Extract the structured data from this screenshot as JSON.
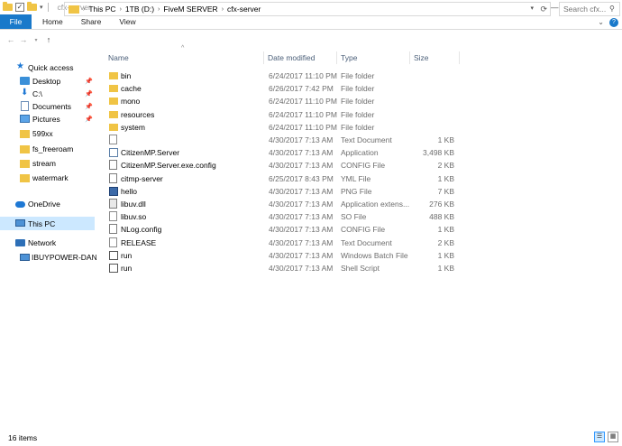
{
  "window": {
    "title": "cfx-server",
    "buttons": {
      "minimize": "—",
      "maximize": "❐",
      "close": "✕"
    }
  },
  "ribbon": {
    "tabs": [
      "File",
      "Home",
      "Share",
      "View"
    ],
    "expand": "⌄"
  },
  "address": {
    "crumbs": [
      "This PC",
      "1TB (D:)",
      "FiveM SERVER",
      "cfx-server"
    ],
    "search_placeholder": "Search cfx..."
  },
  "sidebar": {
    "items": [
      {
        "label": "Quick access",
        "icon": "star-icon",
        "pinned": false
      },
      {
        "label": "Desktop",
        "icon": "desktop-icon",
        "pinned": true
      },
      {
        "label": "C:\\",
        "icon": "download-icon",
        "pinned": true
      },
      {
        "label": "Documents",
        "icon": "document-icon",
        "pinned": true
      },
      {
        "label": "Pictures",
        "icon": "pictures-icon",
        "pinned": true
      },
      {
        "label": "599xx",
        "icon": "folder-icon",
        "pinned": false
      },
      {
        "label": "fs_freeroam",
        "icon": "folder-icon",
        "pinned": false
      },
      {
        "label": "stream",
        "icon": "folder-icon",
        "pinned": false
      },
      {
        "label": "watermark",
        "icon": "folder-icon",
        "pinned": false
      },
      {
        "label": "OneDrive",
        "icon": "cloud-icon",
        "pinned": false
      },
      {
        "label": "This PC",
        "icon": "computer-icon",
        "pinned": false,
        "selected": true
      },
      {
        "label": "Network",
        "icon": "network-icon",
        "pinned": false
      },
      {
        "label": "IBUYPOWER-DANIE",
        "icon": "computer-icon",
        "pinned": false
      }
    ]
  },
  "columns": {
    "name": "Name",
    "date": "Date modified",
    "type": "Type",
    "size": "Size"
  },
  "files": [
    {
      "name": "bin",
      "date": "6/24/2017 11:10 PM",
      "type": "File folder",
      "size": "",
      "icon": "folder-icon"
    },
    {
      "name": "cache",
      "date": "6/26/2017 7:42 PM",
      "type": "File folder",
      "size": "",
      "icon": "folder-icon"
    },
    {
      "name": "mono",
      "date": "6/24/2017 11:10 PM",
      "type": "File folder",
      "size": "",
      "icon": "folder-icon"
    },
    {
      "name": "resources",
      "date": "6/24/2017 11:10 PM",
      "type": "File folder",
      "size": "",
      "icon": "folder-icon"
    },
    {
      "name": "system",
      "date": "6/24/2017 11:10 PM",
      "type": "File folder",
      "size": "",
      "icon": "folder-icon"
    },
    {
      "name": "",
      "date": "4/30/2017 7:13 AM",
      "type": "Text Document",
      "size": "1 KB",
      "icon": "text-file-icon"
    },
    {
      "name": "CitizenMP.Server",
      "date": "4/30/2017 7:13 AM",
      "type": "Application",
      "size": "3,498 KB",
      "icon": "application-icon"
    },
    {
      "name": "CitizenMP.Server.exe.config",
      "date": "4/30/2017 7:13 AM",
      "type": "CONFIG File",
      "size": "2 KB",
      "icon": "config-file-icon"
    },
    {
      "name": "citmp-server",
      "date": "6/25/2017 8:43 PM",
      "type": "YML File",
      "size": "1 KB",
      "icon": "yml-file-icon"
    },
    {
      "name": "hello",
      "date": "4/30/2017 7:13 AM",
      "type": "PNG File",
      "size": "7 KB",
      "icon": "image-file-icon"
    },
    {
      "name": "libuv.dll",
      "date": "4/30/2017 7:13 AM",
      "type": "Application extens...",
      "size": "276 KB",
      "icon": "dll-file-icon"
    },
    {
      "name": "libuv.so",
      "date": "4/30/2017 7:13 AM",
      "type": "SO File",
      "size": "488 KB",
      "icon": "file-icon"
    },
    {
      "name": "NLog.config",
      "date": "4/30/2017 7:13 AM",
      "type": "CONFIG File",
      "size": "1 KB",
      "icon": "config-file-icon"
    },
    {
      "name": "RELEASE",
      "date": "4/30/2017 7:13 AM",
      "type": "Text Document",
      "size": "2 KB",
      "icon": "text-file-icon"
    },
    {
      "name": "run",
      "date": "4/30/2017 7:13 AM",
      "type": "Windows Batch File",
      "size": "1 KB",
      "icon": "batch-file-icon"
    },
    {
      "name": "run",
      "date": "4/30/2017 7:13 AM",
      "type": "Shell Script",
      "size": "1 KB",
      "icon": "script-file-icon"
    }
  ],
  "status": {
    "item_count": "16 items"
  }
}
